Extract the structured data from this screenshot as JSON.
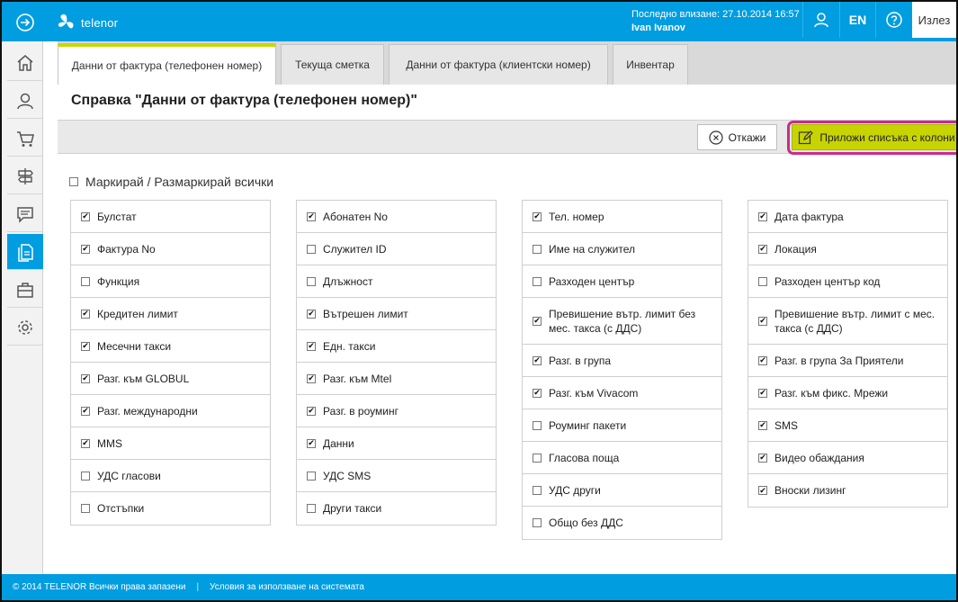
{
  "brand": {
    "logo_text": "telenor",
    "accent": "#009de0",
    "highlight": "#c8d400",
    "ring": "#cc2a8a"
  },
  "header": {
    "last_login_label": "Последно влизане: 27.10.2014 16:57",
    "user_name": "Ivan Ivanov",
    "lang_label": "EN",
    "logout_label": "Излез",
    "icons": [
      "arrow-right-circle-icon",
      "user-icon",
      "help-icon"
    ]
  },
  "nav": {
    "items": [
      {
        "icon": "home-icon",
        "active": false
      },
      {
        "icon": "user-icon",
        "active": false
      },
      {
        "icon": "cart-icon",
        "active": false
      },
      {
        "icon": "signpost-icon",
        "active": false
      },
      {
        "icon": "chat-icon",
        "active": false
      },
      {
        "icon": "documents-icon",
        "active": true
      },
      {
        "icon": "briefcase-icon",
        "active": false
      },
      {
        "icon": "gear-icon",
        "active": false
      }
    ]
  },
  "tabs": [
    {
      "label": "Данни от фактура (телефонен номер)",
      "active": true
    },
    {
      "label": "Текуща сметка",
      "active": false
    },
    {
      "label": "Данни от фактура (клиентски номер)",
      "active": false
    },
    {
      "label": "Инвентар",
      "active": false
    }
  ],
  "page": {
    "title": "Справка \"Данни от фактура (телефонен номер)\""
  },
  "toolbar": {
    "cancel_label": "Откажи",
    "apply_label": "Приложи списъка с колони"
  },
  "select_all": {
    "label": "Маркирай / Размаркирай всички",
    "checked": false
  },
  "columns": [
    [
      {
        "label": "Булстат",
        "checked": true
      },
      {
        "label": "Фактура No",
        "checked": true
      },
      {
        "label": "Функция",
        "checked": false
      },
      {
        "label": "Кредитен лимит",
        "checked": true
      },
      {
        "label": "Месечни такси",
        "checked": true
      },
      {
        "label": "Разг. към GLOBUL",
        "checked": true
      },
      {
        "label": "Разг. международни",
        "checked": true
      },
      {
        "label": "MMS",
        "checked": true
      },
      {
        "label": "УДС гласови",
        "checked": false
      },
      {
        "label": "Отстъпки",
        "checked": false
      }
    ],
    [
      {
        "label": "Абонатен No",
        "checked": true
      },
      {
        "label": "Служител ID",
        "checked": false
      },
      {
        "label": "Длъжност",
        "checked": false
      },
      {
        "label": "Вътрешен лимит",
        "checked": true
      },
      {
        "label": "Едн. такси",
        "checked": true
      },
      {
        "label": "Разг. към Mtel",
        "checked": true
      },
      {
        "label": "Разг. в роуминг",
        "checked": true
      },
      {
        "label": "Данни",
        "checked": true
      },
      {
        "label": "УДС SMS",
        "checked": false
      },
      {
        "label": "Други такси",
        "checked": false
      }
    ],
    [
      {
        "label": "Тел. номер",
        "checked": true
      },
      {
        "label": "Име на служител",
        "checked": false
      },
      {
        "label": "Разходен център",
        "checked": false
      },
      {
        "label": "Превишение вътр. лимит без мес. такса (с ДДС)",
        "checked": true,
        "tall": true
      },
      {
        "label": "Разг. в група",
        "checked": true
      },
      {
        "label": "Разг. към Vivacom",
        "checked": true
      },
      {
        "label": "Роуминг пакети",
        "checked": false
      },
      {
        "label": "Гласова поща",
        "checked": false
      },
      {
        "label": "УДС други",
        "checked": false
      },
      {
        "label": "Общо без ДДС",
        "checked": false
      }
    ],
    [
      {
        "label": "Дата фактура",
        "checked": true
      },
      {
        "label": "Локация",
        "checked": true
      },
      {
        "label": "Разходен център код",
        "checked": false
      },
      {
        "label": "Превишение вътр. лимит с мес. такса (с ДДС)",
        "checked": true,
        "tall": true
      },
      {
        "label": "Разг. в група За Приятели",
        "checked": true
      },
      {
        "label": "Разг. към фикс. Мрежи",
        "checked": true
      },
      {
        "label": "SMS",
        "checked": true
      },
      {
        "label": "Видео обаждания",
        "checked": true
      },
      {
        "label": "Вноски лизинг",
        "checked": true
      }
    ]
  ],
  "footer": {
    "copyright": "© 2014 TELENOR Всички права запазени",
    "separator": "|",
    "terms_label": "Условия за използване на системата"
  }
}
